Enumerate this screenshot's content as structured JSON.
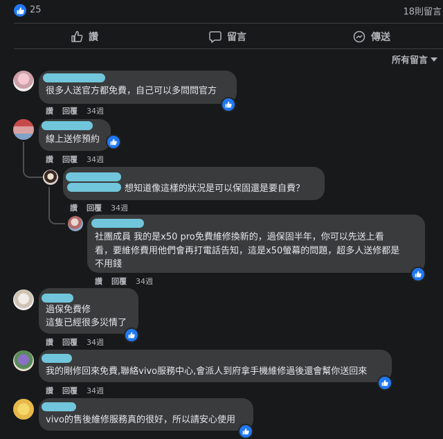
{
  "stats": {
    "like_count": "25",
    "share_count": "18則留言"
  },
  "actions": {
    "like": "讚",
    "comment": "留言",
    "share": "傳送"
  },
  "sort_label": "所有留言",
  "meta": {
    "like": "讚",
    "reply": "回覆",
    "time": "34週"
  },
  "comments": [
    {
      "lines": [
        "很多人送官方都免費，自己可以多問問官方"
      ]
    },
    {
      "lines": [
        "線上送修預約"
      ]
    },
    {
      "lines": [
        "想知道像這樣的狀況是可以保固還是要自費？"
      ]
    },
    {
      "lines": [
        "社團成員  我的是x50 pro免費維修換新的，過保固半年，你可以先送上看",
        "看，要維修費用他們會再打電話告知，這是x50螢幕的問題，超多人送修都是",
        "不用錢"
      ]
    },
    {
      "lines": [
        "過保免費修",
        "這隻已經很多災情了"
      ]
    },
    {
      "lines": [
        "我的剛修回來免費,聯絡vivo服務中心,會派人到府拿手機維修過後還會幫你送回來"
      ]
    },
    {
      "lines": [
        "vivo的售後維修服務真的很好，所以請安心使用"
      ]
    }
  ],
  "colors": {
    "background": "#18191a",
    "bubble": "#3a3b3c",
    "accent": "#2078f4",
    "muted": "#b0b3b8"
  },
  "icons": {
    "like": "thumbs-up-icon",
    "comment": "speech-bubble-icon",
    "share": "messenger-icon",
    "sort": "caret-down-icon"
  }
}
